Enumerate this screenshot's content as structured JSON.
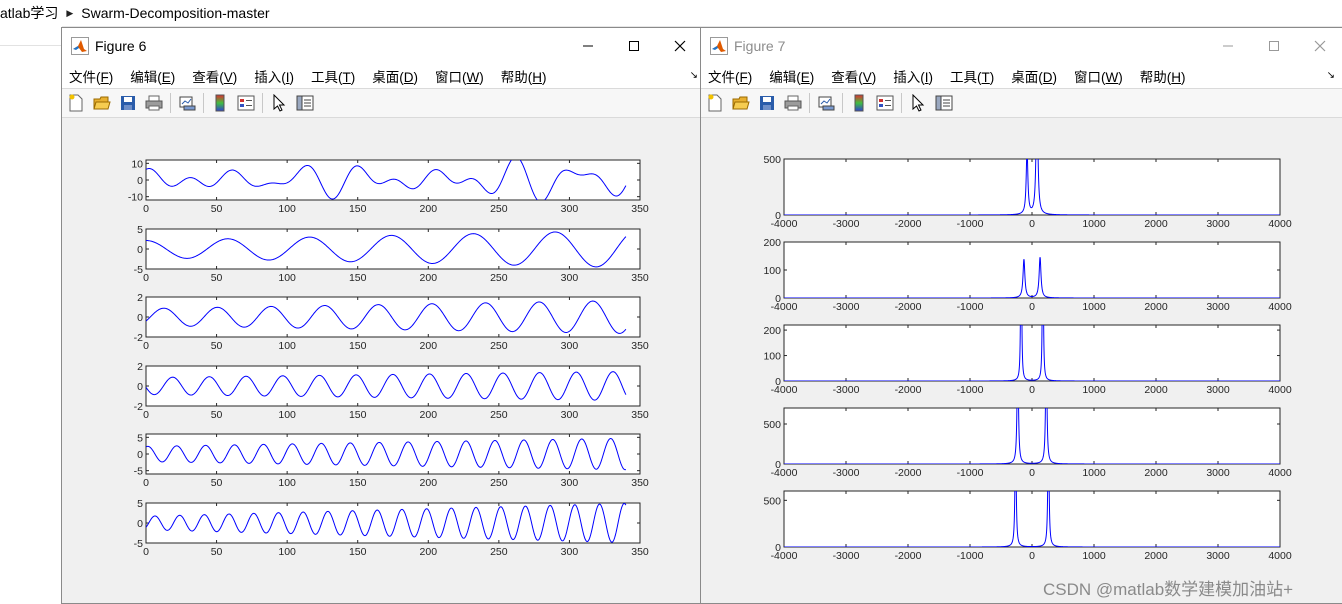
{
  "breadcrumb": {
    "items": [
      "atlab学习",
      "Swarm-Decomposition-master"
    ]
  },
  "menu": [
    "文件(F)",
    "编辑(E)",
    "查看(V)",
    "插入(I)",
    "工具(T)",
    "桌面(D)",
    "窗口(W)",
    "帮助(H)"
  ],
  "menu_keys": [
    "F",
    "E",
    "V",
    "I",
    "T",
    "D",
    "W",
    "H"
  ],
  "icons": [
    "new-figure-icon",
    "open-file-icon",
    "save-icon",
    "print-icon",
    "link-plot-icon",
    "colorbar-icon",
    "legend-icon",
    "edit-plot-icon",
    "property-inspector-icon"
  ],
  "colors": {
    "line": "#0000ff",
    "window_bg": "#f0f0f0",
    "axes_bg": "#ffffff"
  },
  "windows": [
    {
      "title": "Figure 6",
      "active": true
    },
    {
      "title": "Figure 7",
      "active": false
    }
  ],
  "watermark": "CSDN @matlab数学建模加油站+",
  "chart_data": [
    {
      "type": "line",
      "figure": "Figure 6",
      "xlim": [
        0,
        350
      ],
      "xticks": [
        "0",
        "50",
        "100",
        "150",
        "200",
        "250",
        "300",
        "350"
      ],
      "n_points": 340,
      "series": [
        {
          "ylim": [
            -12,
            12
          ],
          "yticks": [
            "10",
            "0",
            "-10"
          ],
          "tick_values": [
            10,
            0,
            -10
          ],
          "components": [
            {
              "amp": 4,
              "period": 50,
              "phase": 0.5
            },
            {
              "amp": 3.5,
              "period": 29,
              "phase": 1.2
            },
            {
              "amp": 2.5,
              "period": 38,
              "phase": 2.0
            }
          ],
          "grow": 0.8
        },
        {
          "ylim": [
            -5,
            5
          ],
          "yticks": [
            "5",
            "0",
            "-5"
          ],
          "tick_values": [
            5,
            0,
            -5
          ],
          "components": [
            {
              "amp": 2.5,
              "period": 58,
              "phase": 1.6
            }
          ],
          "grow": 1.0
        },
        {
          "ylim": [
            -2,
            2
          ],
          "yticks": [
            "2",
            "0",
            "-2"
          ],
          "tick_values": [
            2,
            0,
            -2
          ],
          "components": [
            {
              "amp": 1.0,
              "period": 38,
              "phase": -0.5
            }
          ],
          "grow": 0.8
        },
        {
          "ylim": [
            -2,
            2
          ],
          "yticks": [
            "2",
            "0",
            "-2"
          ],
          "tick_values": [
            2,
            0,
            -2
          ],
          "components": [
            {
              "amp": 1.0,
              "period": 26,
              "phase": 3.3
            }
          ],
          "grow": 0.6
        },
        {
          "ylim": [
            -6,
            6
          ],
          "yticks": [
            "5",
            "0",
            "-5"
          ],
          "tick_values": [
            5,
            0,
            -5
          ],
          "components": [
            {
              "amp": 2.7,
              "period": 20.5,
              "phase": 1.2
            }
          ],
          "grow": 0.9
        },
        {
          "ylim": [
            -5,
            5
          ],
          "yticks": [
            "5",
            "0",
            "-5"
          ],
          "tick_values": [
            5,
            0,
            -5
          ],
          "components": [
            {
              "amp": 2.0,
              "period": 17.5,
              "phase": -0.7
            }
          ],
          "grow": 1.6
        }
      ]
    },
    {
      "type": "line",
      "figure": "Figure 7",
      "xlim": [
        -4000,
        4000
      ],
      "xticks": [
        "-4000",
        "-3000",
        "-2000",
        "-1000",
        "0",
        "1000",
        "2000",
        "3000",
        "4000"
      ],
      "series": [
        {
          "ylim": [
            0,
            500
          ],
          "yticks": [
            "500",
            "0"
          ],
          "tick_values": [
            500,
            0
          ],
          "peak_x": 80,
          "peak_h": 1200,
          "width": 16,
          "left_ratio": 0.48
        },
        {
          "ylim": [
            0,
            200
          ],
          "yticks": [
            "200",
            "100",
            "0"
          ],
          "tick_values": [
            200,
            100,
            0
          ],
          "peak_x": 130,
          "peak_h": 145,
          "width": 18,
          "left_ratio": 0.95
        },
        {
          "ylim": [
            0,
            220
          ],
          "yticks": [
            "200",
            "100",
            "0"
          ],
          "tick_values": [
            200,
            100,
            0
          ],
          "peak_x": 175,
          "peak_h": 1000,
          "width": 7,
          "left_ratio": 1.0
        },
        {
          "ylim": [
            0,
            700
          ],
          "yticks": [
            "500",
            "0"
          ],
          "tick_values": [
            500,
            0
          ],
          "peak_x": 230,
          "peak_h": 1600,
          "width": 12,
          "left_ratio": 1.0
        },
        {
          "ylim": [
            0,
            600
          ],
          "yticks": [
            "500",
            "0"
          ],
          "tick_values": [
            500,
            0
          ],
          "peak_x": 265,
          "peak_h": 1400,
          "width": 11,
          "left_ratio": 0.95
        }
      ]
    }
  ]
}
